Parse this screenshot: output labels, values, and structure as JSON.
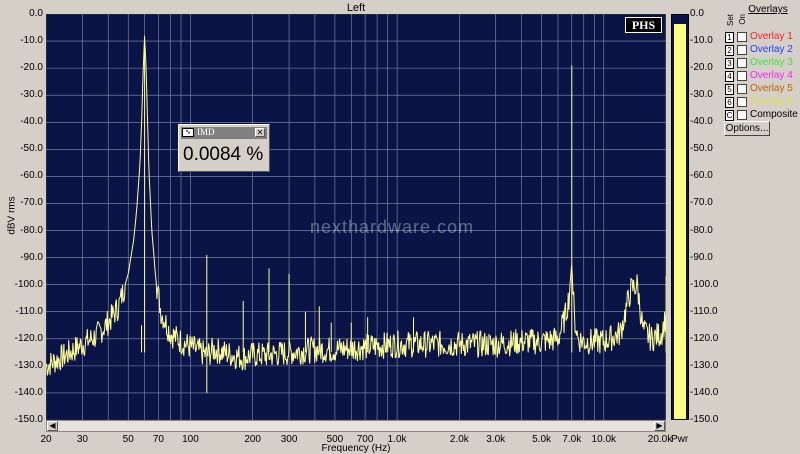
{
  "window": {
    "title": "Left"
  },
  "brand": {
    "badge": "PHS",
    "watermark": "nexthardware.com"
  },
  "imd_box": {
    "title": "IMD",
    "value": "0.0084 %",
    "close_symbol": "✕"
  },
  "overlays": {
    "title": "Overlays",
    "col_set": "Set",
    "col_on": "On",
    "items": [
      {
        "num": "1",
        "label": "Overlay 1",
        "color": "#ff2020"
      },
      {
        "num": "2",
        "label": "Overlay 2",
        "color": "#2040ff"
      },
      {
        "num": "3",
        "label": "Overlay 3",
        "color": "#40e040"
      },
      {
        "num": "4",
        "label": "Overlay 4",
        "color": "#ff20ff"
      },
      {
        "num": "5",
        "label": "Overlay 5",
        "color": "#c06000"
      },
      {
        "num": "6",
        "label": "Overlay 6",
        "color": "#e0e040"
      },
      {
        "num": "C",
        "label": "Composite",
        "color": "#000000"
      }
    ],
    "options_label": "Options..."
  },
  "power_meter": {
    "label": "Pwr",
    "level_db": -3.5,
    "fill_color": "#ffff80"
  },
  "chart_data": {
    "type": "line",
    "title": "Left",
    "xlabel": "Frequency (Hz)",
    "ylabel": "dBV rms",
    "xscale": "log",
    "xlim": [
      20,
      20000
    ],
    "ylim": [
      -150,
      0
    ],
    "grid": true,
    "x_ticks": [
      "20",
      "30",
      "50",
      "70",
      "100",
      "200",
      "300",
      "500",
      "700",
      "1.0k",
      "2.0k",
      "3.0k",
      "5.0k",
      "7.0k",
      "10.0k",
      "20.0k"
    ],
    "x_tick_values": [
      20,
      30,
      50,
      70,
      100,
      200,
      300,
      500,
      700,
      1000,
      2000,
      3000,
      5000,
      7000,
      10000,
      20000
    ],
    "y_ticks": [
      "0.0",
      "-10.0",
      "-20.0",
      "-30.0",
      "-40.0",
      "-50.0",
      "-60.0",
      "-70.0",
      "-80.0",
      "-90.0",
      "-100.0",
      "-110.0",
      "-120.0",
      "-130.0",
      "-140.0",
      "-150.0"
    ],
    "y_tick_values": [
      0,
      -10,
      -20,
      -30,
      -40,
      -50,
      -60,
      -70,
      -80,
      -90,
      -100,
      -110,
      -120,
      -130,
      -140,
      -150
    ],
    "power_ticks": [
      "0.0",
      "-10.0",
      "-20.0",
      "-30.0",
      "-40.0",
      "-50.0",
      "-60.0",
      "-70.0",
      "-80.0",
      "-90.0",
      "-100.0",
      "-110.0",
      "-120.0",
      "-130.0",
      "-140.0",
      "-150.0"
    ],
    "line_color": "#ffff99",
    "series": [
      {
        "x": [
          20,
          25,
          30,
          35,
          40,
          45,
          50,
          53,
          55,
          57,
          58,
          59,
          60,
          61,
          62,
          63,
          65,
          68,
          72,
          80,
          90,
          100,
          120,
          130,
          160,
          180,
          200,
          240,
          300,
          400,
          500,
          700,
          1000,
          1500,
          2000,
          3000,
          4000,
          5000,
          6000,
          6500,
          6800,
          7000,
          7100,
          7200,
          7500,
          8000,
          9000,
          10000,
          12000,
          13500,
          14500,
          15500,
          17000,
          19000,
          20000
        ],
        "y": [
          -130,
          -126,
          -122,
          -119,
          -114,
          -108,
          -96,
          -84,
          -72,
          -55,
          -40,
          -22,
          -8,
          -20,
          -40,
          -58,
          -80,
          -98,
          -110,
          -118,
          -121,
          -123,
          -126,
          -124,
          -126,
          -127,
          -126,
          -126,
          -125,
          -124,
          -124,
          -123,
          -122,
          -122,
          -122,
          -122,
          -121,
          -121,
          -120,
          -112,
          -104,
          -92,
          -102,
          -112,
          -120,
          -121,
          -121,
          -121,
          -118,
          -102,
          -100,
          -117,
          -120,
          -118,
          -112
        ]
      }
    ],
    "spikes": [
      {
        "x": 7000,
        "y": -19
      },
      {
        "x": 120,
        "y": -89
      },
      {
        "x": 180,
        "y": -106
      },
      {
        "x": 240,
        "y": -94
      },
      {
        "x": 300,
        "y": -96
      },
      {
        "x": 360,
        "y": -110
      },
      {
        "x": 420,
        "y": -108
      },
      {
        "x": 480,
        "y": -114
      },
      {
        "x": 600,
        "y": -114
      },
      {
        "x": 720,
        "y": -112
      },
      {
        "x": 1200,
        "y": -112
      },
      {
        "x": 58,
        "y": -115
      },
      {
        "x": 120,
        "y": -140
      },
      {
        "x": 60,
        "y": -8
      },
      {
        "x": 20000,
        "y": -97
      }
    ]
  }
}
